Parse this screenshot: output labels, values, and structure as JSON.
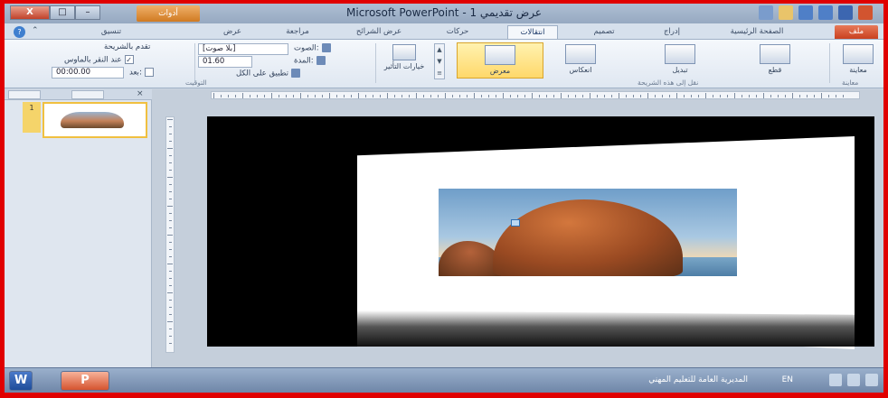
{
  "titlebar": {
    "title": "Microsoft PowerPoint - عرض تقديمي 1",
    "context_tab": "أدوات",
    "min_label": "–",
    "max_label": "□",
    "close_label": "X"
  },
  "tabs": [
    {
      "label": "ملف",
      "kind": "file"
    },
    {
      "label": "الصفحة الرئيسية"
    },
    {
      "label": "إدراج"
    },
    {
      "label": "تصميم"
    },
    {
      "label": "انتقالات",
      "kind": "active"
    },
    {
      "label": "حركات"
    },
    {
      "label": "عرض الشرائح"
    },
    {
      "label": "مراجعة"
    },
    {
      "label": "عرض"
    },
    {
      "label": "تنسيق"
    }
  ],
  "ribbon": {
    "preview_label": "معاينة",
    "preview_group": "معاينة",
    "transitions": [
      {
        "label": "قطع"
      },
      {
        "label": "تبديل"
      },
      {
        "label": "انعكاس"
      },
      {
        "label": "معرض",
        "selected": true
      }
    ],
    "transitions_group": "نقل إلى هذه الشريحة",
    "effect_options": "خيارات التأثير",
    "sound_label": "الصوت:",
    "sound_value": "[بلا صوت]",
    "duration_label": "المدة:",
    "duration_value": "01.60",
    "apply_all": "تطبيق على الكل",
    "advance_label": "تقدم بالشريحة",
    "on_click": "عند النقر بالماوس",
    "after_label": "بعد:",
    "after_value": "00:00.00",
    "timing_group": "التوقيت"
  },
  "left_panel": {
    "slide_number": "1",
    "close": "×"
  },
  "taskbar": {
    "word": "W",
    "ppt": "P",
    "status": "المديرية العامة للتعليم المهني",
    "lang": "EN"
  },
  "colors": {
    "frame_red": "#e00000",
    "selected_gallery": "#ffd86a",
    "file_tab": "#c9401f"
  }
}
